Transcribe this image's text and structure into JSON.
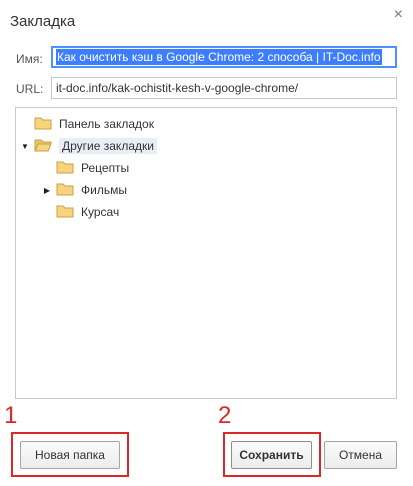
{
  "dialog": {
    "title": "Закладка",
    "close_glyph": "×"
  },
  "fields": {
    "name_label": "Имя:",
    "name_value": "Как очистить кэш в Google Chrome: 2 способа | IT-Doc.info",
    "url_label": "URL:",
    "url_value": "it-doc.info/kak-ochistit-kesh-v-google-chrome/"
  },
  "tree": {
    "items": [
      {
        "label": "Панель закладок",
        "expanded": false,
        "level": 0
      },
      {
        "label": "Другие закладки",
        "expanded": true,
        "level": 0,
        "selected": true
      },
      {
        "label": "Рецепты",
        "level": 1
      },
      {
        "label": "Фильмы",
        "level": 1,
        "expandable": true
      },
      {
        "label": "Курсач",
        "level": 1
      }
    ]
  },
  "buttons": {
    "new_folder": "Новая папка",
    "save": "Сохранить",
    "cancel": "Отмена"
  },
  "annotations": {
    "one": "1",
    "two": "2"
  },
  "colors": {
    "annotation": "#d62a2a",
    "selection": "#3d7eff",
    "folder": "#e8c36a"
  }
}
